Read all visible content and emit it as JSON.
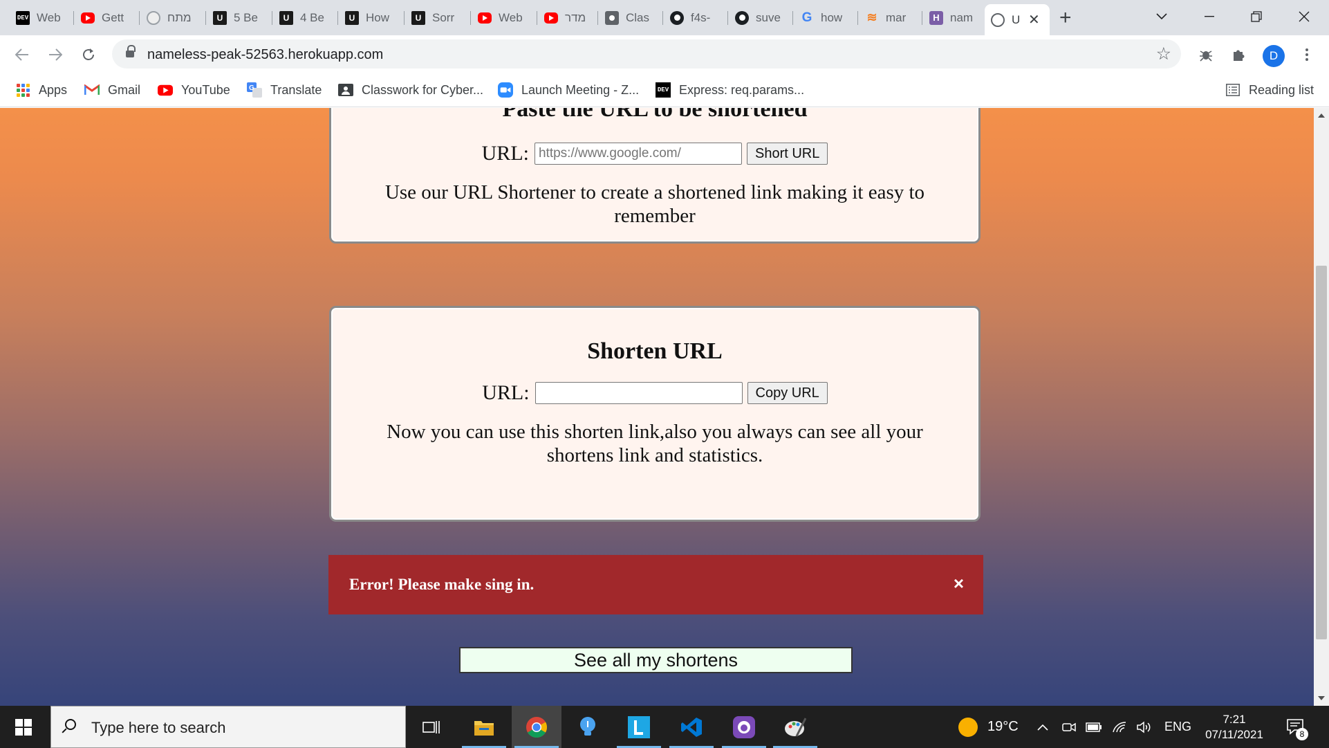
{
  "browser": {
    "tabs": [
      {
        "title": "Web",
        "icon": "dev-icon"
      },
      {
        "title": "Gett",
        "icon": "youtube-icon"
      },
      {
        "title": "מתח",
        "icon": "smiley-icon"
      },
      {
        "title": "5 Be",
        "icon": "udemy-icon"
      },
      {
        "title": "4 Be",
        "icon": "udemy-icon"
      },
      {
        "title": "How",
        "icon": "udemy-icon"
      },
      {
        "title": "Sorr",
        "icon": "udemy-icon"
      },
      {
        "title": "Web",
        "icon": "youtube-icon"
      },
      {
        "title": "מדר",
        "icon": "youtube-icon"
      },
      {
        "title": "Clas",
        "icon": "classroom-icon"
      },
      {
        "title": "f4s-",
        "icon": "github-icon"
      },
      {
        "title": "suve",
        "icon": "github-icon"
      },
      {
        "title": "how",
        "icon": "google-icon"
      },
      {
        "title": "mar",
        "icon": "stackoverflow-icon"
      },
      {
        "title": "nam",
        "icon": "heroku-icon"
      },
      {
        "title": "U",
        "icon": "globe-icon",
        "active": true
      }
    ],
    "address": "nameless-peak-52563.herokuapp.com",
    "avatar_letter": "D",
    "bookmarks": [
      {
        "label": "Apps",
        "icon": "apps-icon"
      },
      {
        "label": "Gmail",
        "icon": "gmail-icon"
      },
      {
        "label": "YouTube",
        "icon": "youtube-icon"
      },
      {
        "label": "Translate",
        "icon": "translate-icon"
      },
      {
        "label": "Classwork for Cyber...",
        "icon": "classroom-icon"
      },
      {
        "label": "Launch Meeting - Z...",
        "icon": "zoom-icon"
      },
      {
        "label": "Express: req.params...",
        "icon": "dev-icon"
      }
    ],
    "reading_list": "Reading list"
  },
  "page": {
    "paste_card": {
      "heading": "Paste the URL to be shortened",
      "url_label": "URL:",
      "url_placeholder": "https://www.google.com/",
      "button": "Short URL",
      "description": "Use our URL Shortener to create a shortened link making it easy to remember"
    },
    "shorten_card": {
      "heading": "Shorten URL",
      "url_label": "URL:",
      "url_value": "",
      "button": "Copy URL",
      "description": "Now you can use this shorten link,also you always can see all your shortens link and statistics."
    },
    "alert": {
      "message": "Error! Please make sing in.",
      "close": "×",
      "color": "#a1282b"
    },
    "see_all_button": "See all my shortens"
  },
  "taskbar": {
    "search_placeholder": "Type here to search",
    "weather": "19°C",
    "language": "ENG",
    "time": "7:21",
    "date": "07/11/2021",
    "notifications": "8"
  }
}
